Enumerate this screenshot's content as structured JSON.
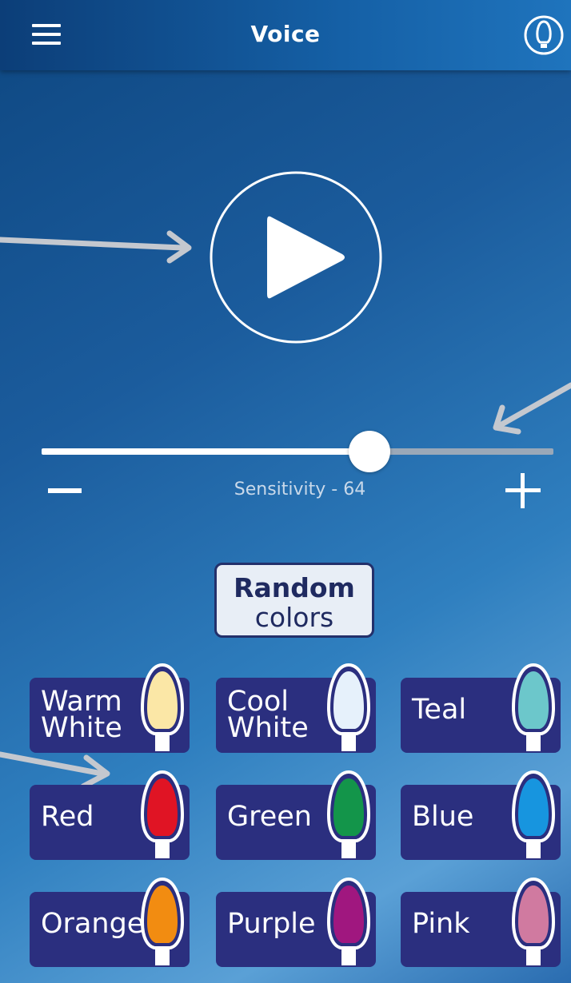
{
  "header": {
    "title": "Voice",
    "menu_icon": "hamburger-menu-icon",
    "bulb_icon": "bulb-icon"
  },
  "player": {
    "play_icon": "play-icon"
  },
  "sensitivity": {
    "label": "Sensitivity - 64",
    "value": 64,
    "min": 0,
    "max": 100
  },
  "random_button": {
    "line1": "Random",
    "line2": "colors"
  },
  "colors": [
    {
      "line1": "Warm",
      "line2": "White",
      "color": "#fbe7a6"
    },
    {
      "line1": "Cool",
      "line2": "White",
      "color": "#e6f1fb"
    },
    {
      "line1": "Teal",
      "line2": "",
      "color": "#6cc7cb"
    },
    {
      "line1": "Red",
      "line2": "",
      "color": "#e01424"
    },
    {
      "line1": "Green",
      "line2": "",
      "color": "#13954a"
    },
    {
      "line1": "Blue",
      "line2": "",
      "color": "#1795df"
    },
    {
      "line1": "Orange",
      "line2": "",
      "color": "#f28c11"
    },
    {
      "line1": "Purple",
      "line2": "",
      "color": "#a0177f"
    },
    {
      "line1": "Pink",
      "line2": "",
      "color": "#d07aa0"
    }
  ],
  "theme": {
    "button_bg": "#2b2f7f",
    "arrow_color": "#c4c8cf"
  }
}
